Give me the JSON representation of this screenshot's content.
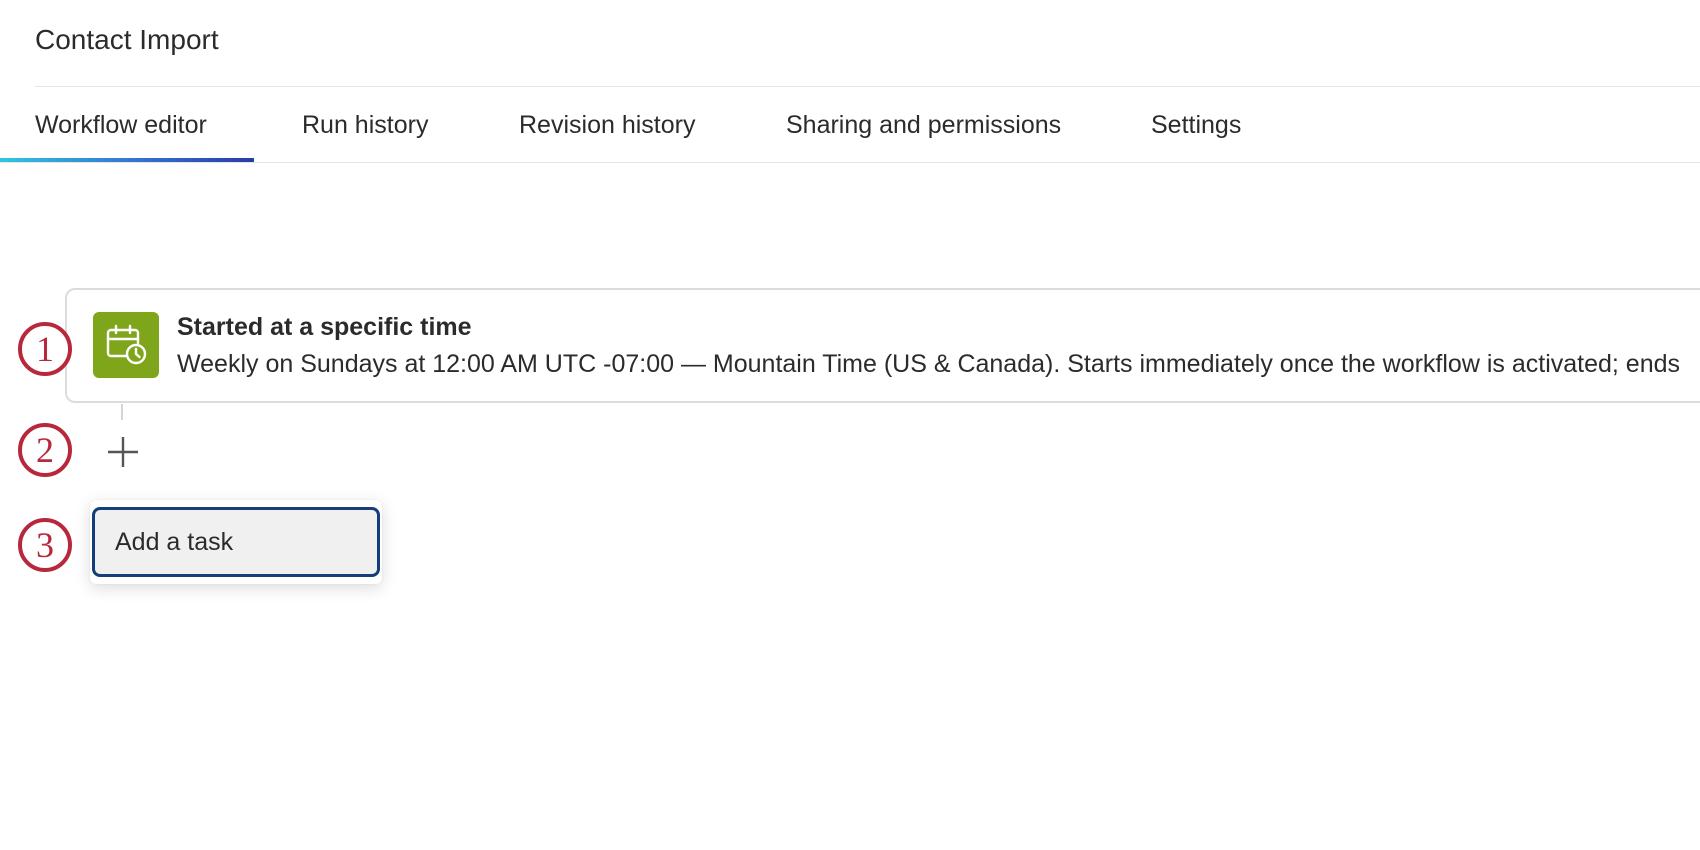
{
  "header": {
    "title": "Contact Import"
  },
  "tabs": [
    {
      "label": "Workflow editor",
      "active": true
    },
    {
      "label": "Run history",
      "active": false
    },
    {
      "label": "Revision history",
      "active": false
    },
    {
      "label": "Sharing and permissions",
      "active": false
    },
    {
      "label": "Settings",
      "active": false
    }
  ],
  "trigger": {
    "icon": "calendar-clock-icon",
    "title": "Started at a specific time",
    "description": "Weekly on Sundays at 12:00 AM UTC -07:00 — Mountain Time (US & Canada). Starts immediately once the workflow is activated; ends"
  },
  "add_menu": {
    "plus_icon": "plus-icon",
    "items": [
      {
        "label": "Add a task"
      }
    ]
  },
  "markers": [
    {
      "label": "1"
    },
    {
      "label": "2"
    },
    {
      "label": "3"
    }
  ],
  "colors": {
    "accent_marker": "#b8283d",
    "trigger_icon_bg": "#7fa61a",
    "focus_border": "#163e7a",
    "tab_underline_start": "#2fc6e0",
    "tab_underline_end": "#2a3ba8"
  }
}
